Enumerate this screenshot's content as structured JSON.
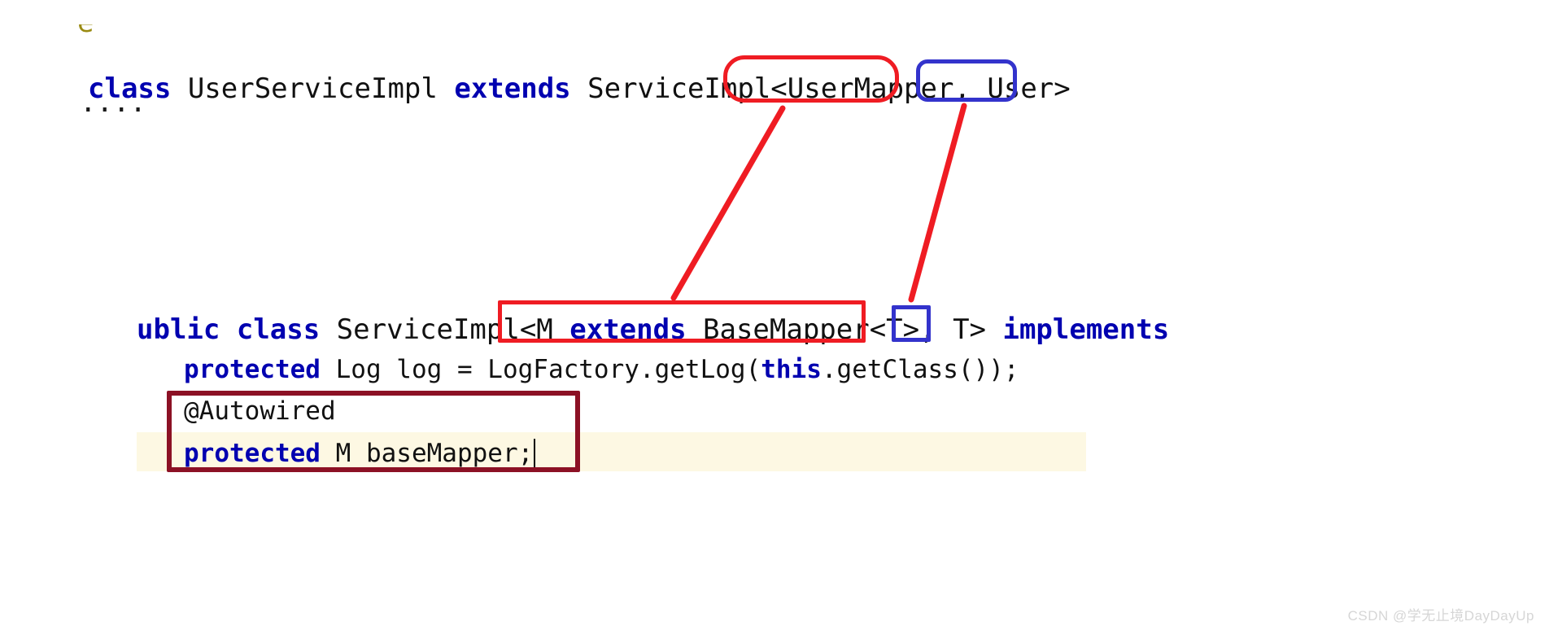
{
  "editor": {
    "background_color": "#ffffff",
    "text_color": "#111111",
    "keyword_color": "#0000b0",
    "highlight_line_color": "#fdf8e3",
    "clipped_top_text": "e",
    "clipped_under_text": "....`"
  },
  "code": {
    "line1": {
      "kw_class": "class",
      "rest_a": " UserServiceImpl ",
      "kw_extends": "extends",
      "rest_b": " ServiceImpl<UserMapper, User>"
    },
    "line2": {
      "kw_public": "ublic",
      "sp_a": " ",
      "kw_class": "class",
      "rest_a": " ServiceImpl<M ",
      "kw_extends": "extends",
      "rest_b": " BaseMapper<T>, T> ",
      "kw_implements": "implements"
    },
    "line3": {
      "kw_protected": "protected",
      "rest_a": " Log log = LogFactory.getLog(",
      "kw_this": "this",
      "rest_b": ".getClass());"
    },
    "line4": {
      "annotation": "@Autowired"
    },
    "line5": {
      "kw_protected": "protected",
      "rest_a": " M baseMapper;"
    }
  },
  "annotations": {
    "box_usermapper": {
      "label": "UserMapper",
      "color": "#ef1c23",
      "shape": "rounded-rect"
    },
    "box_user": {
      "label": "User>",
      "color": "#3333cc",
      "shape": "rounded-rect"
    },
    "box_m_extends": {
      "label": "M extends BaseMapper<T>",
      "color": "#ef1c23",
      "shape": "rect"
    },
    "box_t": {
      "label": "T>",
      "color": "#3333cc",
      "shape": "rect"
    },
    "box_autowired": {
      "label": "@Autowired protected M baseMapper;",
      "color": "#8c1125",
      "shape": "rect"
    },
    "connector_usermapper_to_m": {
      "color": "#ef1c23",
      "from": "UserMapper",
      "to": "M extends BaseMapper<T>"
    },
    "connector_user_to_t": {
      "color": "#ef1c23",
      "from": "User>",
      "to": "T>"
    }
  },
  "watermark": {
    "text": "CSDN @学无止境DayDayUp",
    "color": "#d6d6d6"
  }
}
